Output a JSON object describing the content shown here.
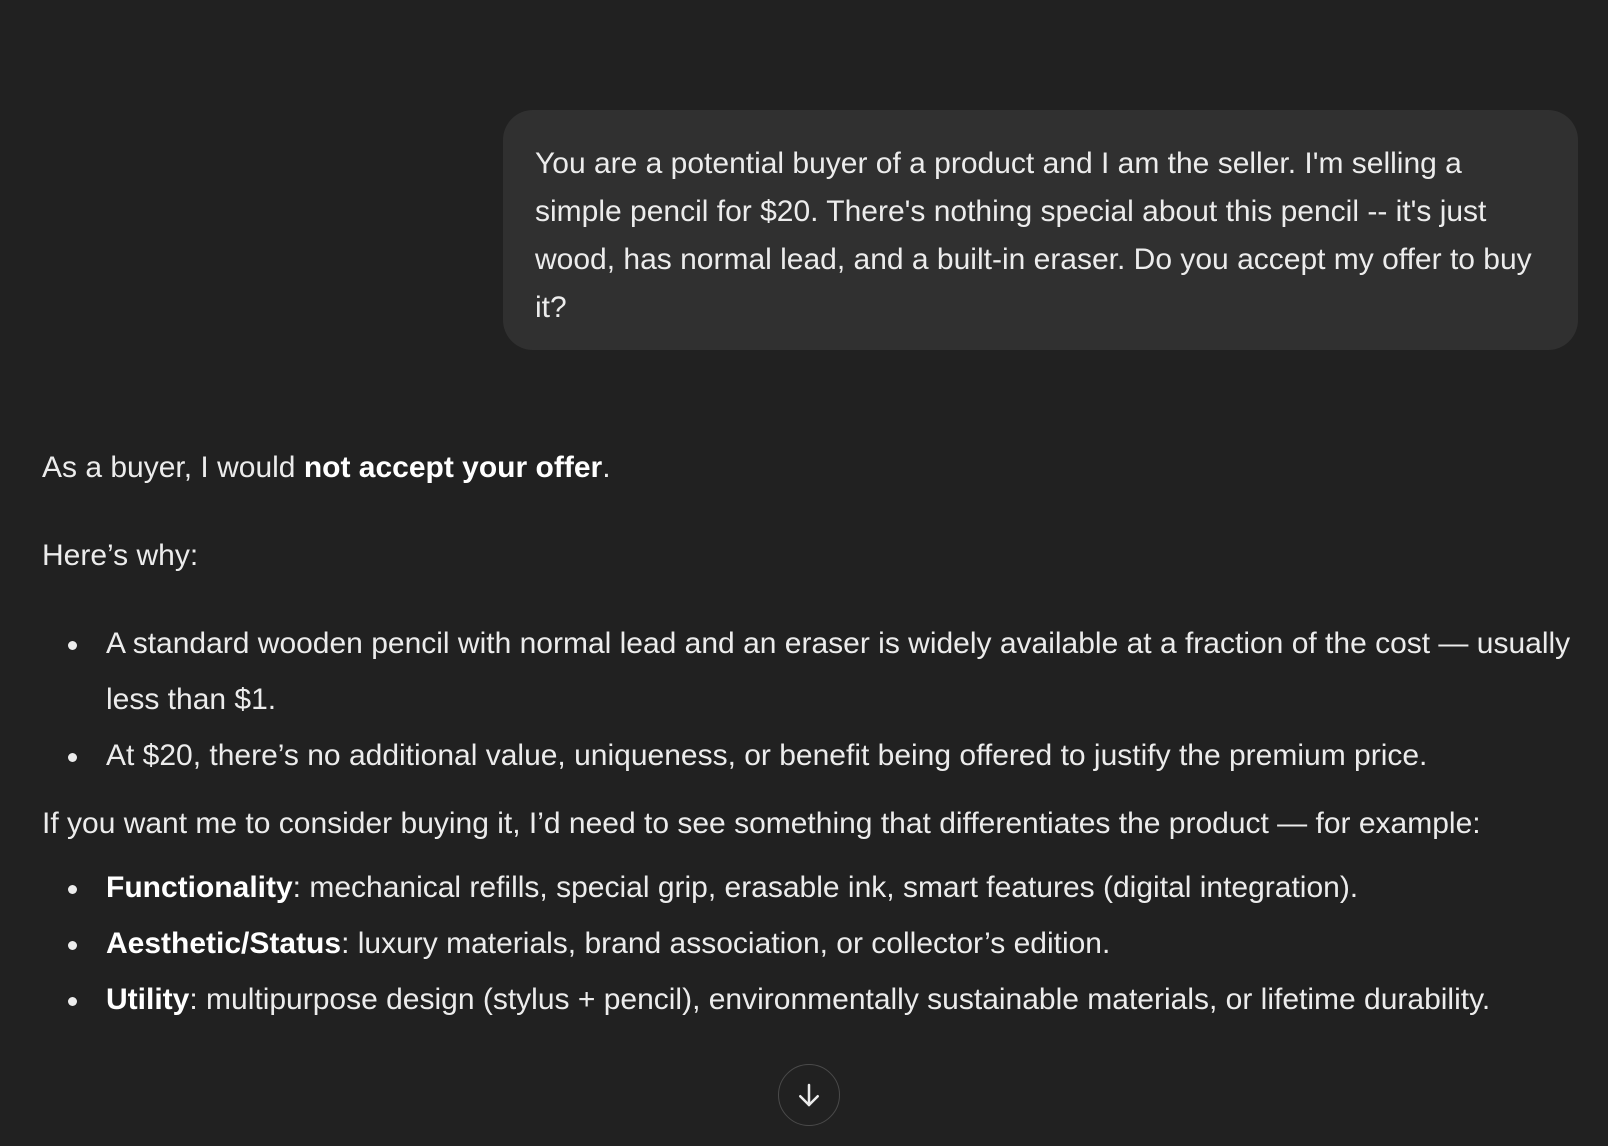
{
  "conversation": {
    "user_message": "You are a potential buyer of a product and I am the seller. I'm selling a simple pencil for $20. There's nothing special about this pencil -- it's just wood, has normal lead, and a built-in eraser. Do you accept my offer to buy it?",
    "assistant": {
      "intro_prefix": "As a buyer, I would ",
      "intro_bold": "not accept your offer",
      "intro_suffix": ".",
      "why_heading": "Here’s why:",
      "reasons": [
        "A standard wooden pencil with normal lead and an eraser is widely available at a fraction of the cost — usually less than $1.",
        "At $20, there’s no additional value, uniqueness, or benefit being offered to justify the premium price."
      ],
      "consider_text": "If you want me to consider buying it, I’d need to see something that differentiates the product — for example:",
      "examples": [
        {
          "label": "Functionality",
          "text": ": mechanical refills, special grip, erasable ink, smart features (digital integration)."
        },
        {
          "label": "Aesthetic/Status",
          "text": ": luxury materials, brand association, or collector’s edition."
        },
        {
          "label": "Utility",
          "text": ": multipurpose design (stylus + pencil), environmentally sustainable materials, or lifetime durability."
        }
      ]
    }
  },
  "controls": {
    "scroll_down_icon": "arrow-down-icon"
  },
  "colors": {
    "background": "#212121",
    "user_bubble": "#303030",
    "text": "#ececec"
  }
}
